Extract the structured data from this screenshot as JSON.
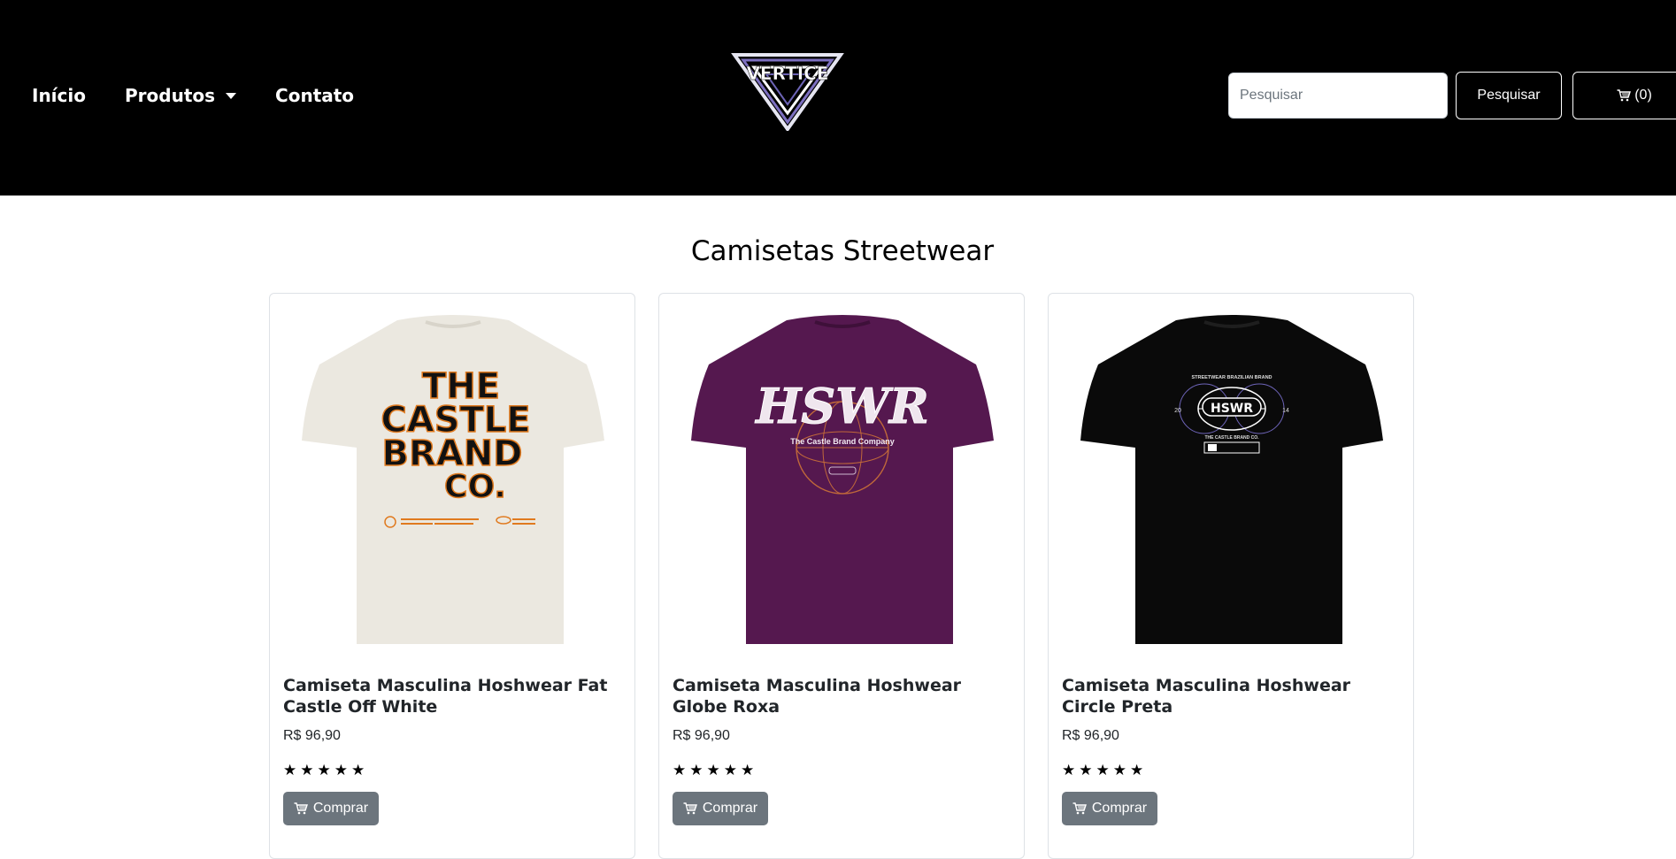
{
  "nav": {
    "links": [
      {
        "label": "Início"
      },
      {
        "label": "Produtos"
      },
      {
        "label": "Contato"
      }
    ],
    "logo_text": "VERTICE",
    "search_placeholder": "Pesquisar",
    "search_button": "Pesquisar",
    "cart_label": "(0)"
  },
  "section_title": "Camisetas Streetwear",
  "products": [
    {
      "title": "Camiseta Masculina Hoshwear Fat Castle Off White",
      "price": "R$ 96,90",
      "rating": 5,
      "stars": "★★★★★",
      "buy_label": "Comprar",
      "shirt_color": "#ebe8e0",
      "print_text": [
        "THE",
        "CASTLE",
        "BRAND",
        "CO."
      ]
    },
    {
      "title": "Camiseta Masculina Hoshwear Globe Roxa",
      "price": "R$ 96,90",
      "rating": 5,
      "stars": "★★★★★",
      "buy_label": "Comprar",
      "shirt_color": "#55184f",
      "print_text": [
        "HSWR",
        "The Castle Brand Company"
      ]
    },
    {
      "title": "Camiseta Masculina Hoshwear Circle Preta",
      "price": "R$ 96,90",
      "rating": 5,
      "stars": "★★★★★",
      "buy_label": "Comprar",
      "shirt_color": "#0a0a0a",
      "print_text": [
        "STREETWEAR BRAZILIAN BRAND",
        "HSWR",
        "20",
        "14",
        "THE CASTLE BRAND CO."
      ]
    }
  ],
  "colors": {
    "navbar_bg": "#000000",
    "button_secondary": "#6c757d",
    "accent_orange": "#e07a1f"
  }
}
